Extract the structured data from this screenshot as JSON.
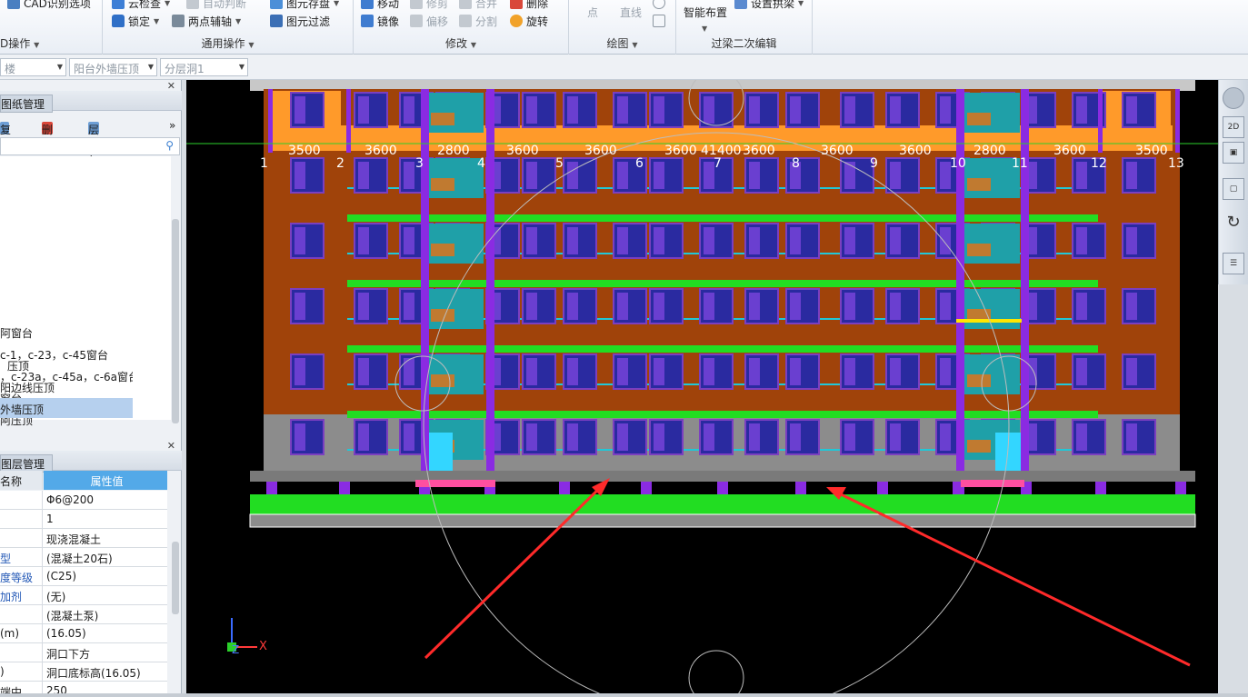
{
  "ribbon": {
    "groups": [
      {
        "title": "D操作",
        "buttons": [
          "CAD识别选项"
        ]
      },
      {
        "title": "通用操作",
        "buttons": [
          "云检查",
          "锁定",
          "两点辅轴",
          "图元存盘",
          "图元过滤",
          "自动判断"
        ]
      },
      {
        "title": "修改",
        "buttons": [
          "移动",
          "修剪",
          "合并",
          "删除",
          "镜像",
          "偏移",
          "分割",
          "旋转"
        ]
      },
      {
        "title": "绘图",
        "buttons": [
          "点",
          "直线"
        ]
      },
      {
        "title": "过梁二次编辑",
        "buttons": [
          "智能布置",
          "设置拱梁"
        ]
      }
    ]
  },
  "selectors": {
    "layer": "楼",
    "component_type": "阳台外墙压顶",
    "component": "分层洞1"
  },
  "drawing_panel": {
    "title": "图纸管理",
    "tools": [
      "复制",
      "删除",
      "层间复制"
    ],
    "items": [
      "阿窗台",
      "c-1，c-23，c-45窗台",
      "，c-23a，c-45a，c-6a窗台",
      "窗台",
      "阿压顶",
      "压顶",
      "阳边线压顶",
      "外墙压顶"
    ],
    "selected_index": 7
  },
  "layer_panel": {
    "title": "图层管理",
    "header": {
      "name": "名称",
      "value": "属性值"
    },
    "rows": [
      {
        "name": "",
        "value": "Φ6@200",
        "blue": false
      },
      {
        "name": "",
        "value": "1",
        "blue": false
      },
      {
        "name": "",
        "value": "现浇混凝土",
        "blue": false
      },
      {
        "name": "型",
        "value": "(混凝土20石)",
        "blue": true
      },
      {
        "name": "度等级",
        "value": "(C25)",
        "blue": true
      },
      {
        "name": "加剂",
        "value": "(无)",
        "blue": true
      },
      {
        "name": "",
        "value": "(混凝土泵)",
        "blue": false
      },
      {
        "name": "(m)",
        "value": "(16.05)",
        "blue": false
      },
      {
        "name": "",
        "value": "洞口下方",
        "blue": false
      },
      {
        "name": ")",
        "value": "洞口底标高(16.05)",
        "blue": false
      },
      {
        "name": "端中",
        "value": "250",
        "blue": false
      }
    ]
  },
  "viewport": {
    "axis_numbers": [
      "1",
      "2",
      "3",
      "4",
      "5",
      "6",
      "7",
      "8",
      "9",
      "10",
      "11",
      "12",
      "13"
    ],
    "dimensions": [
      "3500",
      "3600",
      "2800",
      "3600",
      "3600",
      "3600",
      "41400",
      "3600",
      "3600",
      "3600",
      "2800",
      "3600",
      "3500"
    ],
    "coordinate_axes": {
      "x": "X",
      "z": "Z"
    },
    "colors": {
      "wall": "#a0430a",
      "slab_green": "#22dd22",
      "column_purple": "#8a2be2",
      "window_blue": "#2a2aa0",
      "base_gray": "#8c8c8c",
      "arrow_red": "#ff2a2a"
    }
  },
  "right_toolbar": {
    "buttons": [
      "orbit-icon",
      "2d-view-icon",
      "3d-view-icon",
      "box-view-icon",
      "rotate-icon",
      "layers-icon"
    ],
    "label_2d": "2D"
  }
}
